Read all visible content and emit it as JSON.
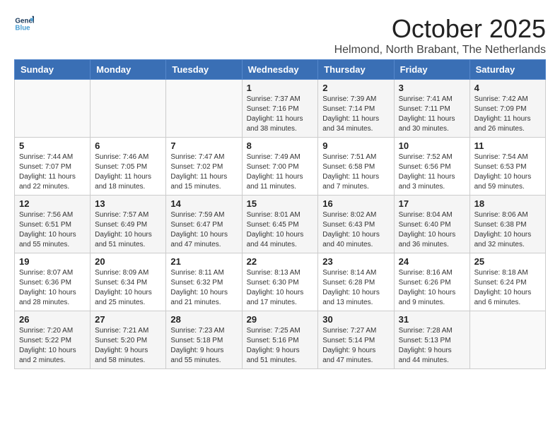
{
  "header": {
    "logo_line1": "General",
    "logo_line2": "Blue",
    "month": "October 2025",
    "location": "Helmond, North Brabant, The Netherlands"
  },
  "weekdays": [
    "Sunday",
    "Monday",
    "Tuesday",
    "Wednesday",
    "Thursday",
    "Friday",
    "Saturday"
  ],
  "rows": [
    [
      {
        "day": "",
        "info": ""
      },
      {
        "day": "",
        "info": ""
      },
      {
        "day": "",
        "info": ""
      },
      {
        "day": "1",
        "info": "Sunrise: 7:37 AM\nSunset: 7:16 PM\nDaylight: 11 hours\nand 38 minutes."
      },
      {
        "day": "2",
        "info": "Sunrise: 7:39 AM\nSunset: 7:14 PM\nDaylight: 11 hours\nand 34 minutes."
      },
      {
        "day": "3",
        "info": "Sunrise: 7:41 AM\nSunset: 7:11 PM\nDaylight: 11 hours\nand 30 minutes."
      },
      {
        "day": "4",
        "info": "Sunrise: 7:42 AM\nSunset: 7:09 PM\nDaylight: 11 hours\nand 26 minutes."
      }
    ],
    [
      {
        "day": "5",
        "info": "Sunrise: 7:44 AM\nSunset: 7:07 PM\nDaylight: 11 hours\nand 22 minutes."
      },
      {
        "day": "6",
        "info": "Sunrise: 7:46 AM\nSunset: 7:05 PM\nDaylight: 11 hours\nand 18 minutes."
      },
      {
        "day": "7",
        "info": "Sunrise: 7:47 AM\nSunset: 7:02 PM\nDaylight: 11 hours\nand 15 minutes."
      },
      {
        "day": "8",
        "info": "Sunrise: 7:49 AM\nSunset: 7:00 PM\nDaylight: 11 hours\nand 11 minutes."
      },
      {
        "day": "9",
        "info": "Sunrise: 7:51 AM\nSunset: 6:58 PM\nDaylight: 11 hours\nand 7 minutes."
      },
      {
        "day": "10",
        "info": "Sunrise: 7:52 AM\nSunset: 6:56 PM\nDaylight: 11 hours\nand 3 minutes."
      },
      {
        "day": "11",
        "info": "Sunrise: 7:54 AM\nSunset: 6:53 PM\nDaylight: 10 hours\nand 59 minutes."
      }
    ],
    [
      {
        "day": "12",
        "info": "Sunrise: 7:56 AM\nSunset: 6:51 PM\nDaylight: 10 hours\nand 55 minutes."
      },
      {
        "day": "13",
        "info": "Sunrise: 7:57 AM\nSunset: 6:49 PM\nDaylight: 10 hours\nand 51 minutes."
      },
      {
        "day": "14",
        "info": "Sunrise: 7:59 AM\nSunset: 6:47 PM\nDaylight: 10 hours\nand 47 minutes."
      },
      {
        "day": "15",
        "info": "Sunrise: 8:01 AM\nSunset: 6:45 PM\nDaylight: 10 hours\nand 44 minutes."
      },
      {
        "day": "16",
        "info": "Sunrise: 8:02 AM\nSunset: 6:43 PM\nDaylight: 10 hours\nand 40 minutes."
      },
      {
        "day": "17",
        "info": "Sunrise: 8:04 AM\nSunset: 6:40 PM\nDaylight: 10 hours\nand 36 minutes."
      },
      {
        "day": "18",
        "info": "Sunrise: 8:06 AM\nSunset: 6:38 PM\nDaylight: 10 hours\nand 32 minutes."
      }
    ],
    [
      {
        "day": "19",
        "info": "Sunrise: 8:07 AM\nSunset: 6:36 PM\nDaylight: 10 hours\nand 28 minutes."
      },
      {
        "day": "20",
        "info": "Sunrise: 8:09 AM\nSunset: 6:34 PM\nDaylight: 10 hours\nand 25 minutes."
      },
      {
        "day": "21",
        "info": "Sunrise: 8:11 AM\nSunset: 6:32 PM\nDaylight: 10 hours\nand 21 minutes."
      },
      {
        "day": "22",
        "info": "Sunrise: 8:13 AM\nSunset: 6:30 PM\nDaylight: 10 hours\nand 17 minutes."
      },
      {
        "day": "23",
        "info": "Sunrise: 8:14 AM\nSunset: 6:28 PM\nDaylight: 10 hours\nand 13 minutes."
      },
      {
        "day": "24",
        "info": "Sunrise: 8:16 AM\nSunset: 6:26 PM\nDaylight: 10 hours\nand 9 minutes."
      },
      {
        "day": "25",
        "info": "Sunrise: 8:18 AM\nSunset: 6:24 PM\nDaylight: 10 hours\nand 6 minutes."
      }
    ],
    [
      {
        "day": "26",
        "info": "Sunrise: 7:20 AM\nSunset: 5:22 PM\nDaylight: 10 hours\nand 2 minutes."
      },
      {
        "day": "27",
        "info": "Sunrise: 7:21 AM\nSunset: 5:20 PM\nDaylight: 9 hours\nand 58 minutes."
      },
      {
        "day": "28",
        "info": "Sunrise: 7:23 AM\nSunset: 5:18 PM\nDaylight: 9 hours\nand 55 minutes."
      },
      {
        "day": "29",
        "info": "Sunrise: 7:25 AM\nSunset: 5:16 PM\nDaylight: 9 hours\nand 51 minutes."
      },
      {
        "day": "30",
        "info": "Sunrise: 7:27 AM\nSunset: 5:14 PM\nDaylight: 9 hours\nand 47 minutes."
      },
      {
        "day": "31",
        "info": "Sunrise: 7:28 AM\nSunset: 5:13 PM\nDaylight: 9 hours\nand 44 minutes."
      },
      {
        "day": "",
        "info": ""
      }
    ]
  ]
}
